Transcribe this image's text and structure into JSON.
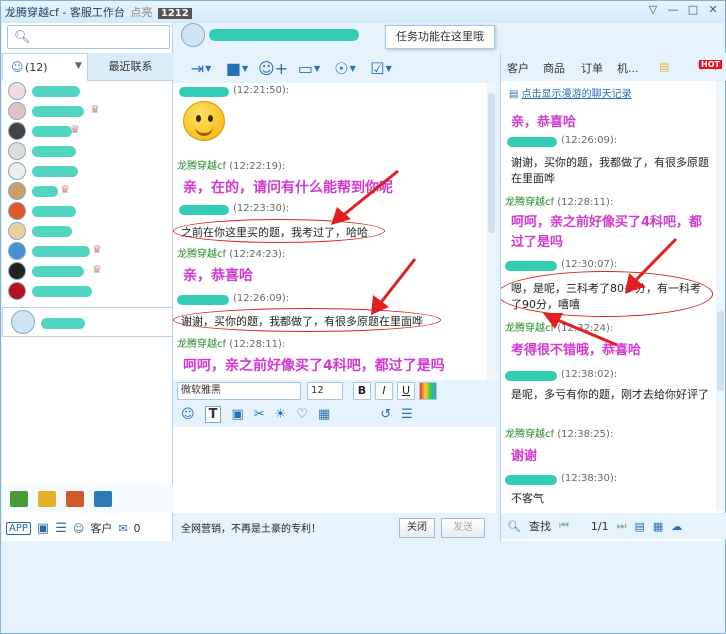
{
  "window": {
    "title": "龙腾穿越cf - 客服工作台",
    "title_tail": "点亮",
    "title_badge": "1212",
    "controls": [
      "▽",
      "—",
      "□",
      "✕"
    ]
  },
  "left": {
    "tab_contacts_count": "(12)",
    "tab_recent": "最近联系",
    "bottom": {
      "app_label": "APP",
      "customer_label": "客户",
      "mail_count": "0"
    }
  },
  "toolbar": {
    "tooltip": "任务功能在这里哦"
  },
  "chat": {
    "messages": [
      {
        "time": "(12:21:50):"
      },
      {
        "name": "龙腾穿越cf",
        "time": "(12:22:19):",
        "text": "亲，在的，请问有什么能帮到你呢"
      },
      {
        "time": "(12:23:30):",
        "text": "之前在你这里买的题，我考过了，哈哈"
      },
      {
        "name": "龙腾穿越cf",
        "time": "(12:24:23):",
        "text": "亲，恭喜哈"
      },
      {
        "time": "(12:26:09):",
        "text": "谢谢，买你的题，我都做了，有很多原题在里面哗"
      },
      {
        "name": "龙腾穿越cf",
        "time": "(12:28:11):",
        "text": "呵呵，亲之前好像买了4科吧，都过了是吗"
      }
    ]
  },
  "format": {
    "font": "微软雅黑",
    "size": "12",
    "bold": "B",
    "italic": "I",
    "underline": "U"
  },
  "send": {
    "ad_text": "全网营销，不再是土豪的专利！",
    "close_label": "关闭",
    "send_label": "发送"
  },
  "right": {
    "tabs": [
      "客户",
      "商品",
      "订单",
      "机..."
    ],
    "hot": "HOT",
    "history_link": "点击显示漫游的聊天记录",
    "messages": [
      {
        "text": "亲，恭喜哈"
      },
      {
        "time": "(12:26:09):",
        "text": "谢谢，买你的题，我都做了，有很多原题在里面哗"
      },
      {
        "name": "龙腾穿越cf",
        "time": "(12:28:11):",
        "text": "呵呵，亲之前好像买了4科吧，都过了是吗"
      },
      {
        "time": "(12:30:07):",
        "text": "嗯，是呢，三科考了80多分，有一科考了90分，嘻嘻"
      },
      {
        "name": "龙腾穿越cf",
        "time": "(12:32:24):",
        "text": "考得很不错哦，恭喜哈"
      },
      {
        "time": "(12:38:02):",
        "text": "是呢，多亏有你的题，刚才去给你好评了"
      },
      {
        "name": "龙腾穿越cf",
        "time": "(12:38:25):",
        "text": "谢谢"
      },
      {
        "time": "(12:38:30):",
        "text": "不客气"
      }
    ],
    "search_label": "查找",
    "page": "1/1"
  }
}
